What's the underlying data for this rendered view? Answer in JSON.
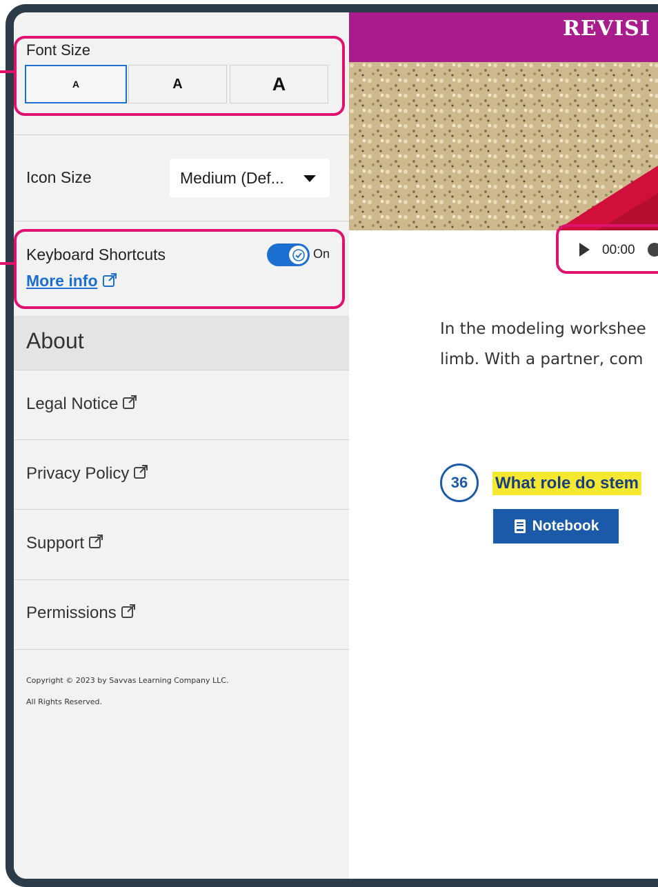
{
  "sidebar": {
    "font_size": {
      "label": "Font Size",
      "options": [
        "A",
        "A",
        "A"
      ],
      "selected_index": 0
    },
    "icon_size": {
      "label": "Icon Size",
      "selected": "Medium (Def..."
    },
    "keyboard_shortcuts": {
      "label": "Keyboard Shortcuts",
      "state": "On",
      "more_info": "More info"
    },
    "about": {
      "heading": "About",
      "links": [
        "Legal Notice",
        "Privacy Policy",
        "Support",
        "Permissions"
      ]
    },
    "copyright": {
      "line1": "Copyright © 2023 by Savvas Learning Company LLC.",
      "line2": "All Rights Reserved."
    }
  },
  "content": {
    "banner_title": "REVISI",
    "audio": {
      "time": "00:00"
    },
    "paragraph": {
      "line1": "In the modeling workshee",
      "line2": "limb. With a partner, com"
    },
    "question": {
      "number": "36",
      "text": "What role do stem"
    },
    "notebook_button": "Notebook"
  },
  "colors": {
    "accent_blue": "#1b6fd1",
    "banner_magenta": "#a81c8c",
    "callout_pink": "#e0116f",
    "question_highlight": "#f5e830",
    "frame": "#2b3b48"
  },
  "icons": [
    "external-link-icon",
    "play-icon",
    "notebook-icon",
    "check-icon",
    "caret-down-icon"
  ]
}
